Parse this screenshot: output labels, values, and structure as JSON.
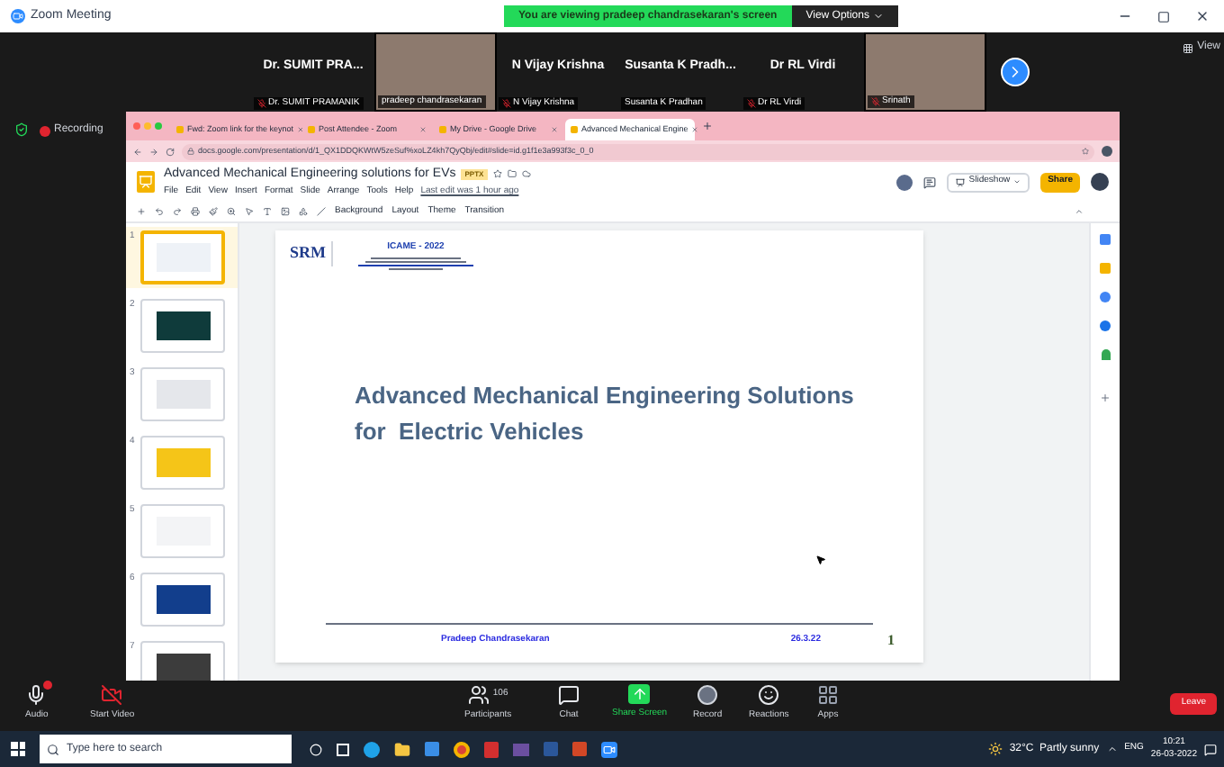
{
  "zoom_window": {
    "title": "Zoom Meeting",
    "banner": "You are viewing pradeep chandrasekaran's screen",
    "view_options": "View Options",
    "view_button": "View"
  },
  "gallery": [
    {
      "kind": "name",
      "name": "Dr. SUMIT PRA...",
      "label": "Dr. SUMIT PRAMANIK",
      "muted": true
    },
    {
      "kind": "video",
      "label": "pradeep chandrasekaran",
      "muted": false
    },
    {
      "kind": "name",
      "name": "N Vijay Krishna",
      "label": "N Vijay Krishna",
      "muted": true
    },
    {
      "kind": "name",
      "name": "Susanta K Pradh...",
      "label": "Susanta K Pradhan",
      "muted": false
    },
    {
      "kind": "name",
      "name": "Dr RL Virdi",
      "label": "Dr RL Virdi",
      "muted": true
    },
    {
      "kind": "video",
      "label": "Srinath",
      "muted": true
    }
  ],
  "recording": "Recording",
  "browser": {
    "tabs": [
      {
        "title": "Fwd: Zoom link for the keynot",
        "selected": false
      },
      {
        "title": "Post Attendee - Zoom",
        "selected": false
      },
      {
        "title": "My Drive - Google Drive",
        "selected": false
      },
      {
        "title": "Advanced Mechanical Engine",
        "selected": true
      }
    ],
    "url": "docs.google.com/presentation/d/1_QX1DDQKWtW5zeSuf%xoLZ4kh7QyQbj/edit#slide=id.g1f1e3a993f3c_0_0"
  },
  "doc": {
    "title": "Advanced Mechanical Engineering solutions for EVs",
    "badge": "PPTX",
    "menus": [
      "File",
      "Edit",
      "View",
      "Insert",
      "Format",
      "Slide",
      "Arrange",
      "Tools",
      "Help"
    ],
    "last_edit": "Last edit was 1 hour ago",
    "slideshow": "Slideshow",
    "share": "Share",
    "tools": [
      "Background",
      "Layout",
      "Theme",
      "Transition"
    ]
  },
  "slides_panel": [
    {
      "number": "1",
      "selected": true
    },
    {
      "number": "2",
      "selected": false
    },
    {
      "number": "3",
      "selected": false
    },
    {
      "number": "4",
      "selected": false
    },
    {
      "number": "5",
      "selected": false
    },
    {
      "number": "6",
      "selected": false
    },
    {
      "number": "7",
      "selected": false
    }
  ],
  "slide": {
    "logo": "SRM",
    "conference": "ICAME - 2022",
    "title_lines": [
      "Advanced Mechanical Engineering Solutions",
      "for  Electric Vehicles"
    ],
    "author": "Pradeep Chandrasekaran",
    "date": "26.3.22",
    "page": "1"
  },
  "controls": [
    {
      "kind": "audio",
      "label": "Audio"
    },
    {
      "kind": "video",
      "label": "Start Video"
    },
    {
      "kind": "participants",
      "label": "Participants",
      "count": "106"
    },
    {
      "kind": "chat",
      "label": "Chat"
    },
    {
      "kind": "share",
      "label": "Share Screen"
    },
    {
      "kind": "record",
      "label": "Record"
    },
    {
      "kind": "reactions",
      "label": "Reactions"
    },
    {
      "kind": "apps",
      "label": "Apps"
    }
  ],
  "leave": "Leave",
  "taskbar": {
    "search": "Type here to search",
    "weather": "32°C  Partly sunny",
    "language": "ENG",
    "time": "10:21",
    "date": "26-03-2022"
  }
}
